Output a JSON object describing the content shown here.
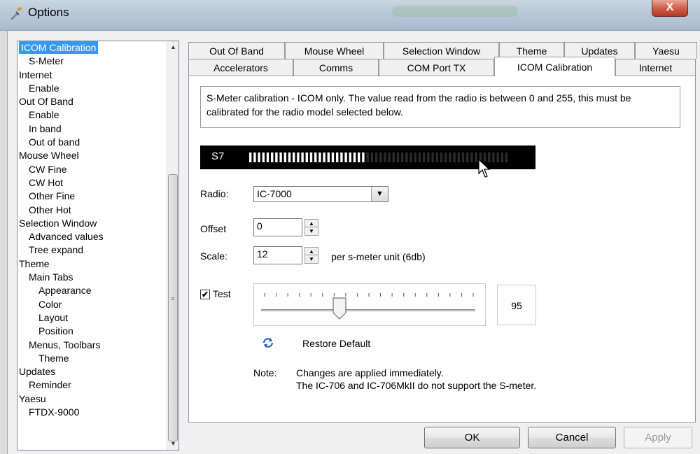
{
  "window": {
    "title": "Options",
    "close_label": "X"
  },
  "tree": {
    "items": [
      {
        "label": "ICOM Calibration",
        "indent": 0,
        "selected": true
      },
      {
        "label": "S-Meter",
        "indent": 1
      },
      {
        "label": "Internet",
        "indent": 0
      },
      {
        "label": "Enable",
        "indent": 1
      },
      {
        "label": "Out Of Band",
        "indent": 0
      },
      {
        "label": "Enable",
        "indent": 1
      },
      {
        "label": "In band",
        "indent": 1
      },
      {
        "label": "Out of band",
        "indent": 1
      },
      {
        "label": "Mouse Wheel",
        "indent": 0
      },
      {
        "label": "CW Fine",
        "indent": 1
      },
      {
        "label": "CW Hot",
        "indent": 1
      },
      {
        "label": "Other Fine",
        "indent": 1
      },
      {
        "label": "Other Hot",
        "indent": 1
      },
      {
        "label": "Selection Window",
        "indent": 0
      },
      {
        "label": "Advanced values",
        "indent": 1
      },
      {
        "label": "Tree expand",
        "indent": 1
      },
      {
        "label": "Theme",
        "indent": 0
      },
      {
        "label": "Main Tabs",
        "indent": 1
      },
      {
        "label": "Appearance",
        "indent": 2
      },
      {
        "label": "Color",
        "indent": 2
      },
      {
        "label": "Layout",
        "indent": 2
      },
      {
        "label": "Position",
        "indent": 2
      },
      {
        "label": "Menus, Toolbars",
        "indent": 1
      },
      {
        "label": "Theme",
        "indent": 2
      },
      {
        "label": "Updates",
        "indent": 0
      },
      {
        "label": "Reminder",
        "indent": 1
      },
      {
        "label": "Yaesu",
        "indent": 0
      },
      {
        "label": "FTDX-9000",
        "indent": 1
      }
    ]
  },
  "tabs": {
    "row1": [
      "Out Of Band",
      "Mouse Wheel",
      "Selection Window",
      "Theme",
      "Updates",
      "Yaesu"
    ],
    "row2": [
      "Accelerators",
      "Comms",
      "COM Port TX",
      "ICOM Calibration",
      "Internet"
    ],
    "active": "ICOM Calibration"
  },
  "panel": {
    "description": "S-Meter calibration - ICOM only. The value read from the radio is between 0 and 255, this must be calibrated for the radio model selected below.",
    "smeter": {
      "label": "S7",
      "total_bars": 60,
      "lit_bars": 27,
      "lit_color": "#ffffff",
      "dim_color": "#2a2a2a"
    },
    "radio_label": "Radio:",
    "radio_value": "IC-7000",
    "offset_label": "Offset",
    "offset_value": "0",
    "scale_label": "Scale:",
    "scale_value": "12",
    "scale_unit": "per s-meter unit (6db)",
    "test_label": "Test",
    "test_checked": true,
    "slider": {
      "value": 95,
      "min": 0,
      "max": 255,
      "tick_count": 19
    },
    "slider_display": "95",
    "restore_label": "Restore Default",
    "note_label": "Note:",
    "note_line1": "Changes are applied immediately.",
    "note_line2": "The IC-706 and IC-706MkII do not support the S-meter."
  },
  "buttons": {
    "ok": "OK",
    "cancel": "Cancel",
    "apply": "Apply"
  }
}
